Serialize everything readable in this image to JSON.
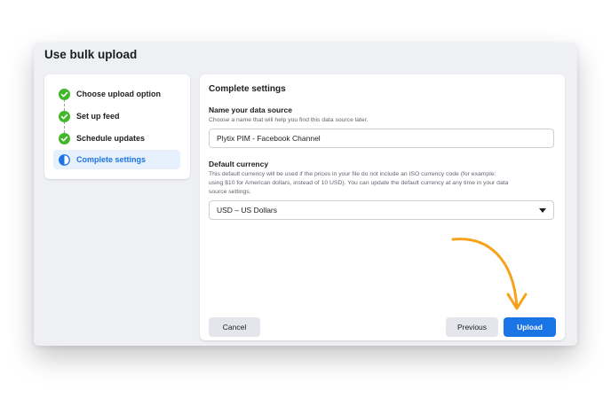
{
  "dialog": {
    "title": "Use bulk upload"
  },
  "steps": [
    {
      "label": "Choose upload option",
      "status": "complete",
      "icon": "check-circle-icon"
    },
    {
      "label": "Set up feed",
      "status": "complete",
      "icon": "check-circle-icon"
    },
    {
      "label": "Schedule updates",
      "status": "complete",
      "icon": "check-circle-icon"
    },
    {
      "label": "Complete settings",
      "status": "active",
      "icon": "half-circle-icon"
    }
  ],
  "panel": {
    "title": "Complete settings",
    "data_source": {
      "label": "Name your data source",
      "help": "Choose a name that will help you find this data source later.",
      "value": "Plytix PIM - Facebook Channel"
    },
    "currency": {
      "label": "Default currency",
      "help_line1": "This default currency will be used if the prices in your file do not include an ISO currency code (for example:",
      "help_line2": "using $10 for American dollars, instead of 10 USD). You can update the default currency at any time in your data",
      "help_line3": "source settings.",
      "selected": "USD – US Dollars"
    }
  },
  "buttons": {
    "cancel": "Cancel",
    "previous": "Previous",
    "upload": "Upload"
  },
  "colors": {
    "accent": "#1b74e4",
    "check": "#42b72a",
    "arrow": "#f7a21b"
  }
}
